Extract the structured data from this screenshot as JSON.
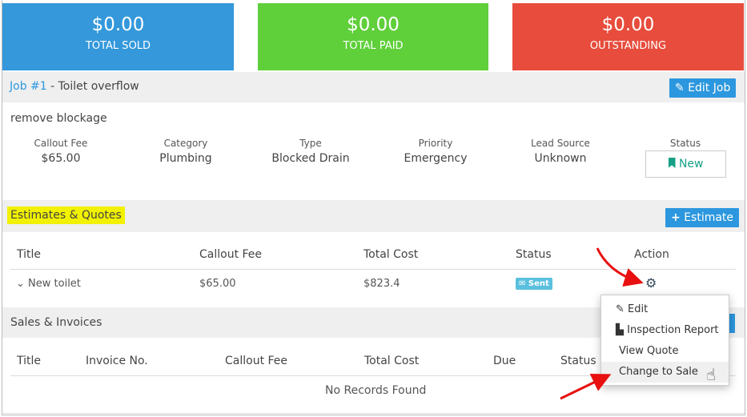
{
  "summary": [
    {
      "amount": "$0.00",
      "label": "TOTAL SOLD",
      "color": "#3498db"
    },
    {
      "amount": "$0.00",
      "label": "TOTAL PAID",
      "color": "#5fcf3a"
    },
    {
      "amount": "$0.00",
      "label": "OUTSTANDING",
      "color": "#e74c3c"
    }
  ],
  "job": {
    "link": "Job #1",
    "title": " - Toilet overflow",
    "edit_label": "Edit Job",
    "description": "remove blockage",
    "meta": [
      {
        "k": "Callout Fee",
        "v": "$65.00"
      },
      {
        "k": "Category",
        "v": "Plumbing"
      },
      {
        "k": "Type",
        "v": "Blocked Drain"
      },
      {
        "k": "Priority",
        "v": "Emergency"
      },
      {
        "k": "Lead Source",
        "v": "Unknown"
      }
    ],
    "status_label": "Status",
    "status": "New"
  },
  "estimates": {
    "title": "Estimates & Quotes",
    "add_label": "Estimate",
    "headers": [
      "Title",
      "Callout Fee",
      "Total Cost",
      "Status",
      "Action"
    ],
    "rows": [
      {
        "title": "New toilet",
        "fee": "$65.00",
        "cost": "$823.4",
        "status": "Sent"
      }
    ]
  },
  "sales": {
    "title": "Sales & Invoices",
    "headers": [
      "Title",
      "Invoice No.",
      "Callout Fee",
      "Total Cost",
      "Due",
      "Status"
    ],
    "empty": "No Records Found"
  },
  "menu": {
    "items": [
      "Edit",
      "Inspection Report",
      "View Quote",
      "Change to Sale"
    ]
  }
}
